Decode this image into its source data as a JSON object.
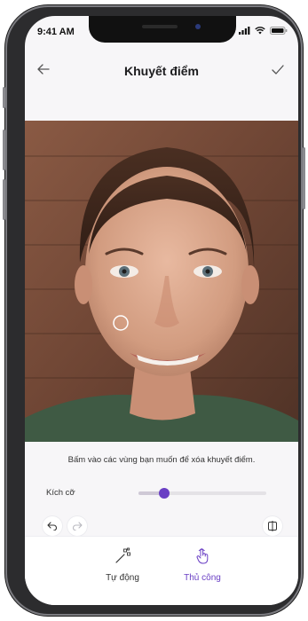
{
  "status_bar": {
    "time": "9:41 AM"
  },
  "header": {
    "title": "Khuyết điểm"
  },
  "editor": {
    "hint": "Bấm vào các vùng bạn muốn để xóa khuyết điểm."
  },
  "size_control": {
    "label": "Kích cỡ",
    "value_fraction": 0.2
  },
  "tabs": [
    {
      "label": "Tự động",
      "icon": "magic-wand-icon",
      "active": false
    },
    {
      "label": "Thủ công",
      "icon": "hand-pointer-icon",
      "active": true
    }
  ],
  "colors": {
    "accent": "#6a3fc4",
    "inactive_text": "#333333"
  }
}
